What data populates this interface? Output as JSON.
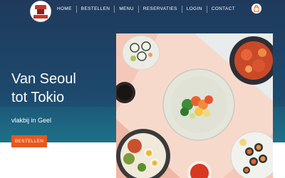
{
  "header": {
    "logo_name": "restaurant-logo",
    "nav": [
      {
        "label": "HOME"
      },
      {
        "label": "BESTELLEN"
      },
      {
        "label": "MENU"
      },
      {
        "label": "RESERVATIES"
      },
      {
        "label": "LOGIN"
      },
      {
        "label": "CONTACT"
      }
    ],
    "cart_icon": "shopping-bag-icon"
  },
  "hero": {
    "title_line1": "Van Seoul",
    "title_line2": "tot Tokio",
    "subtitle": "vlakbij in Geel",
    "cta_label": "BESTELLEN"
  },
  "colors": {
    "header_bg": "#1f3a5c",
    "accent": "#e8581c",
    "text": "#ffffff"
  }
}
